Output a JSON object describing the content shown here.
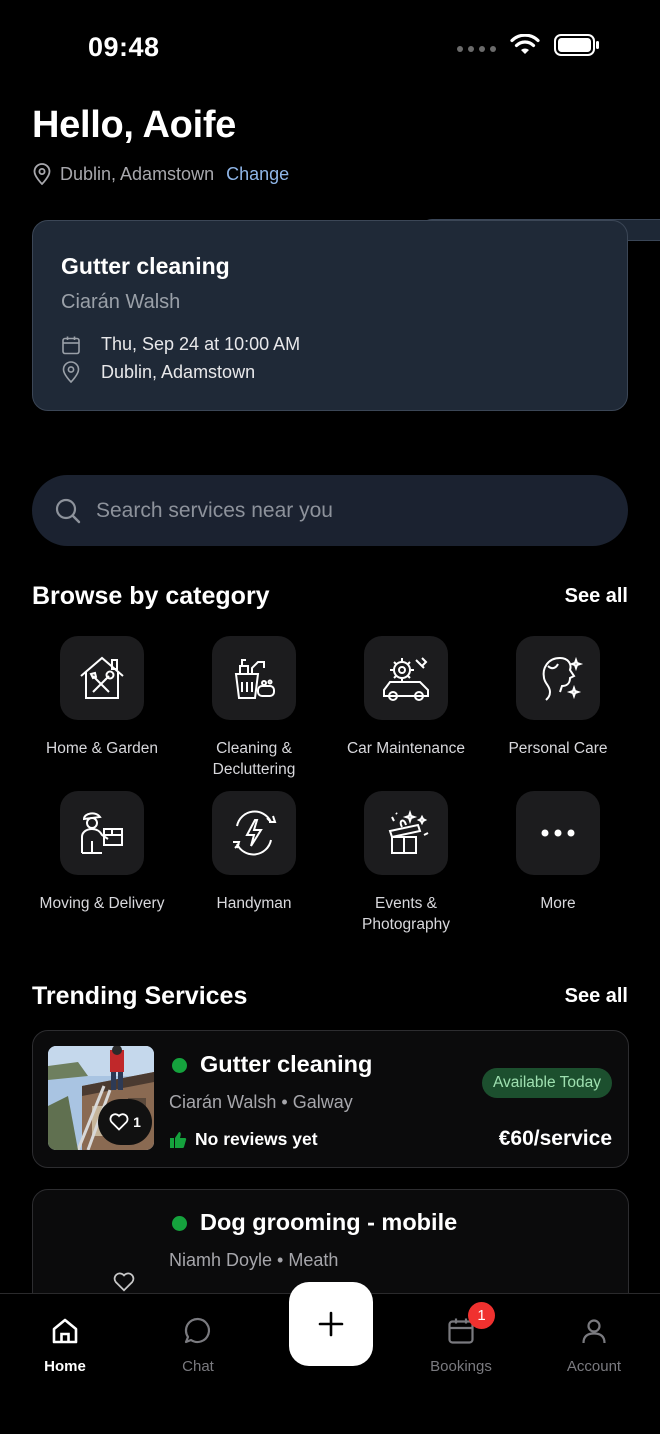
{
  "status_bar": {
    "time": "09:48"
  },
  "header": {
    "greeting": "Hello, Aoife",
    "location": "Dublin, Adamstown",
    "change_label": "Change"
  },
  "booking": {
    "title": "Gutter cleaning",
    "provider": "Ciarán Walsh",
    "datetime": "Thu, Sep 24 at 10:00 AM",
    "location": "Dublin, Adamstown"
  },
  "search": {
    "placeholder": "Search services near you"
  },
  "categories_section": {
    "title": "Browse by category",
    "see_all": "See all",
    "items": [
      {
        "label": "Home & Garden",
        "icon": "house-tools-icon"
      },
      {
        "label": "Cleaning &\nDecluttering",
        "icon": "cleaning-supplies-icon"
      },
      {
        "label": "Car Maintenance",
        "icon": "car-gear-icon"
      },
      {
        "label": "Personal Care",
        "icon": "face-sparkle-icon"
      },
      {
        "label": "Moving & Delivery",
        "icon": "delivery-person-icon"
      },
      {
        "label": "Handyman",
        "icon": "lightning-plug-icon"
      },
      {
        "label": "Events &\nPhotography",
        "icon": "gift-celebration-icon"
      },
      {
        "label": "More",
        "icon": "ellipsis-icon"
      }
    ]
  },
  "trending_section": {
    "title": "Trending Services",
    "see_all": "See all",
    "items": [
      {
        "title": "Gutter cleaning",
        "provider": "Ciarán Walsh",
        "region": "Galway",
        "reviews": "No reviews yet",
        "badge": "Available Today",
        "price": "€60/service",
        "favorites": "1"
      },
      {
        "title": "Dog grooming - mobile",
        "provider": "Niamh Doyle",
        "region": "Meath"
      }
    ]
  },
  "bottom_nav": {
    "home": "Home",
    "chat": "Chat",
    "bookings": "Bookings",
    "bookings_badge": "1",
    "account": "Account"
  },
  "colors": {
    "background": "#000000",
    "card": "#1f2937",
    "accent_link": "#8fb6e8",
    "available_green": "#15a23d",
    "badge_red": "#f0312f"
  }
}
